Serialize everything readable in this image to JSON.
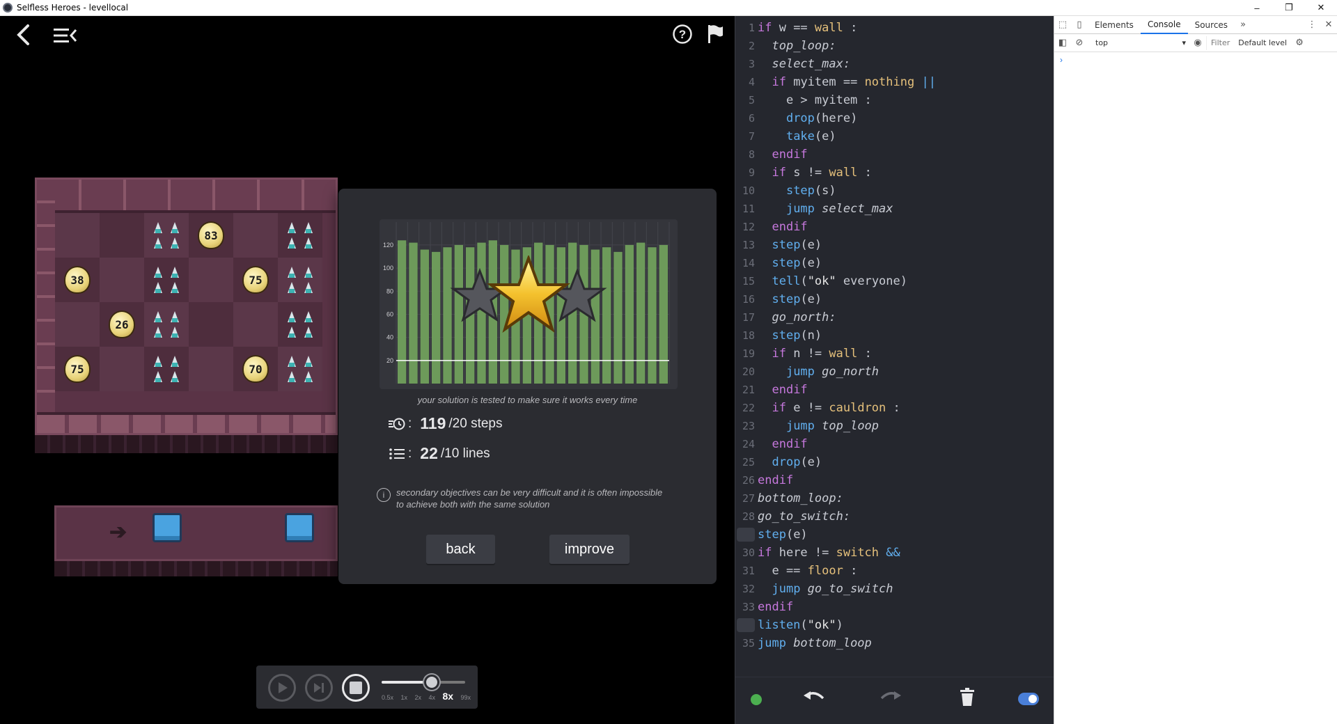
{
  "window": {
    "title": "Selfless Heroes - levellocal"
  },
  "board": {
    "rows": [
      [
        {
          "t": "a"
        },
        {
          "t": "b"
        },
        {
          "t": "a",
          "spikes": true
        },
        {
          "t": "b",
          "egg": "83"
        },
        {
          "t": "a"
        },
        {
          "t": "b",
          "spikes": true
        }
      ],
      [
        {
          "t": "b",
          "egg": "38"
        },
        {
          "t": "a"
        },
        {
          "t": "b",
          "spikes": true
        },
        {
          "t": "a"
        },
        {
          "t": "b",
          "egg": "75"
        },
        {
          "t": "a",
          "spikes": true
        }
      ],
      [
        {
          "t": "a"
        },
        {
          "t": "b",
          "egg": "26"
        },
        {
          "t": "a",
          "spikes": true
        },
        {
          "t": "b"
        },
        {
          "t": "a"
        },
        {
          "t": "b",
          "spikes": true
        }
      ],
      [
        {
          "t": "b",
          "egg": "75"
        },
        {
          "t": "a"
        },
        {
          "t": "b",
          "spikes": true
        },
        {
          "t": "a"
        },
        {
          "t": "b",
          "egg": "70"
        },
        {
          "t": "a",
          "spikes": true
        }
      ]
    ]
  },
  "results": {
    "caption": "your solution is tested to make sure it works every time",
    "steps_value": "119",
    "steps_target": "/20 steps",
    "lines_value": "22",
    "lines_target": "/10 lines",
    "note": "secondary objectives can be very difficult and it is often impossible to achieve both with the same solution",
    "back_label": "back",
    "improve_label": "improve",
    "stars_earned": 1,
    "stars_total": 3
  },
  "chart_data": {
    "type": "bar",
    "y_ticks": [
      20,
      40,
      60,
      80,
      100,
      120
    ],
    "ylim": [
      0,
      135
    ],
    "values": [
      124,
      122,
      116,
      114,
      118,
      120,
      118,
      122,
      124,
      120,
      116,
      118,
      122,
      120,
      118,
      122,
      120,
      116,
      118,
      114,
      120,
      122,
      118,
      120
    ],
    "reference_line": 20,
    "color": "#6d9a5a"
  },
  "player": {
    "speeds": [
      "0.5x",
      "1x",
      "2x",
      "4x",
      "8x",
      "99x"
    ],
    "selected_speed": "8x",
    "slider_fraction": 0.6
  },
  "code": [
    {
      "n": "1",
      "parts": [
        [
          "kw",
          "if "
        ],
        [
          "op",
          "w == "
        ],
        [
          "id",
          "wall"
        ],
        [
          "op",
          " :"
        ]
      ]
    },
    {
      "n": "2",
      "parts": [
        [
          "op",
          "  "
        ],
        [
          "lbl",
          "top_loop:"
        ]
      ]
    },
    {
      "n": "3",
      "parts": [
        [
          "op",
          "  "
        ],
        [
          "lbl",
          "select_max:"
        ]
      ]
    },
    {
      "n": "4",
      "parts": [
        [
          "op",
          "  "
        ],
        [
          "kw",
          "if "
        ],
        [
          "op",
          "myitem == "
        ],
        [
          "id",
          "nothing"
        ],
        [
          "op",
          " "
        ],
        [
          "fn",
          "||"
        ]
      ]
    },
    {
      "n": "5",
      "parts": [
        [
          "op",
          "    e > myitem :"
        ]
      ]
    },
    {
      "n": "6",
      "parts": [
        [
          "op",
          "    "
        ],
        [
          "fn",
          "drop"
        ],
        [
          "op",
          "(here)"
        ]
      ]
    },
    {
      "n": "7",
      "parts": [
        [
          "op",
          "    "
        ],
        [
          "fn",
          "take"
        ],
        [
          "op",
          "(e)"
        ]
      ]
    },
    {
      "n": "8",
      "parts": [
        [
          "op",
          "  "
        ],
        [
          "kw",
          "endif"
        ]
      ]
    },
    {
      "n": "9",
      "parts": [
        [
          "op",
          "  "
        ],
        [
          "kw",
          "if "
        ],
        [
          "op",
          "s != "
        ],
        [
          "id",
          "wall"
        ],
        [
          "op",
          " :"
        ]
      ]
    },
    {
      "n": "10",
      "parts": [
        [
          "op",
          "    "
        ],
        [
          "fn",
          "step"
        ],
        [
          "op",
          "(s)"
        ]
      ]
    },
    {
      "n": "11",
      "parts": [
        [
          "op",
          "    "
        ],
        [
          "fn",
          "jump "
        ],
        [
          "lbl",
          "select_max"
        ]
      ]
    },
    {
      "n": "12",
      "parts": [
        [
          "op",
          "  "
        ],
        [
          "kw",
          "endif"
        ]
      ]
    },
    {
      "n": "13",
      "parts": [
        [
          "op",
          "  "
        ],
        [
          "fn",
          "step"
        ],
        [
          "op",
          "(e)"
        ]
      ]
    },
    {
      "n": "14",
      "parts": [
        [
          "op",
          "  "
        ],
        [
          "fn",
          "step"
        ],
        [
          "op",
          "(e)"
        ]
      ]
    },
    {
      "n": "15",
      "parts": [
        [
          "op",
          "  "
        ],
        [
          "fn",
          "tell"
        ],
        [
          "op",
          "("
        ],
        [
          "str",
          "\"ok\""
        ],
        [
          "op",
          " everyone)"
        ]
      ]
    },
    {
      "n": "16",
      "parts": [
        [
          "op",
          "  "
        ],
        [
          "fn",
          "step"
        ],
        [
          "op",
          "(e)"
        ]
      ]
    },
    {
      "n": "17",
      "parts": [
        [
          "op",
          "  "
        ],
        [
          "lbl",
          "go_north:"
        ]
      ]
    },
    {
      "n": "18",
      "parts": [
        [
          "op",
          "  "
        ],
        [
          "fn",
          "step"
        ],
        [
          "op",
          "(n)"
        ]
      ]
    },
    {
      "n": "19",
      "parts": [
        [
          "op",
          "  "
        ],
        [
          "kw",
          "if "
        ],
        [
          "op",
          "n != "
        ],
        [
          "id",
          "wall"
        ],
        [
          "op",
          " :"
        ]
      ]
    },
    {
      "n": "20",
      "parts": [
        [
          "op",
          "    "
        ],
        [
          "fn",
          "jump "
        ],
        [
          "lbl",
          "go_north"
        ]
      ]
    },
    {
      "n": "21",
      "parts": [
        [
          "op",
          "  "
        ],
        [
          "kw",
          "endif"
        ]
      ]
    },
    {
      "n": "22",
      "parts": [
        [
          "op",
          "  "
        ],
        [
          "kw",
          "if "
        ],
        [
          "op",
          "e != "
        ],
        [
          "id",
          "cauldron"
        ],
        [
          "op",
          " :"
        ]
      ]
    },
    {
      "n": "23",
      "parts": [
        [
          "op",
          "    "
        ],
        [
          "fn",
          "jump "
        ],
        [
          "lbl",
          "top_loop"
        ]
      ]
    },
    {
      "n": "24",
      "parts": [
        [
          "op",
          "  "
        ],
        [
          "kw",
          "endif"
        ]
      ]
    },
    {
      "n": "25",
      "parts": [
        [
          "op",
          "  "
        ],
        [
          "fn",
          "drop"
        ],
        [
          "op",
          "(e)"
        ]
      ]
    },
    {
      "n": "26",
      "parts": [
        [
          "kw",
          "endif"
        ]
      ]
    },
    {
      "n": "27",
      "parts": [
        [
          "lbl",
          "bottom_loop:"
        ]
      ]
    },
    {
      "n": "28",
      "parts": [
        [
          "lbl",
          "go_to_switch:"
        ]
      ]
    },
    {
      "n": "",
      "marker": true,
      "parts": [
        [
          "fn",
          "step"
        ],
        [
          "op",
          "(e)"
        ]
      ]
    },
    {
      "n": "30",
      "parts": [
        [
          "kw",
          "if "
        ],
        [
          "op",
          "here != "
        ],
        [
          "id",
          "switch"
        ],
        [
          "op",
          " "
        ],
        [
          "fn",
          "&&"
        ]
      ]
    },
    {
      "n": "31",
      "parts": [
        [
          "op",
          "  e == "
        ],
        [
          "id",
          "floor"
        ],
        [
          "op",
          " :"
        ]
      ]
    },
    {
      "n": "32",
      "parts": [
        [
          "op",
          "  "
        ],
        [
          "fn",
          "jump "
        ],
        [
          "lbl",
          "go_to_switch"
        ]
      ]
    },
    {
      "n": "33",
      "parts": [
        [
          "kw",
          "endif"
        ]
      ]
    },
    {
      "n": "",
      "marker": true,
      "parts": [
        [
          "fn",
          "listen"
        ],
        [
          "op",
          "("
        ],
        [
          "str",
          "\"ok\""
        ],
        [
          "op",
          ")"
        ]
      ]
    },
    {
      "n": "35",
      "parts": [
        [
          "fn",
          "jump "
        ],
        [
          "lbl",
          "bottom_loop"
        ]
      ]
    }
  ],
  "devtools": {
    "tabs": [
      "Elements",
      "Console",
      "Sources"
    ],
    "active_tab": "Console",
    "context": "top",
    "filter_placeholder": "Filter",
    "level": "Default level",
    "prompt": "›"
  },
  "colors": {
    "editor_bg": "#25272e",
    "accent_blue": "#4a7fd8",
    "status_green": "#4caf50"
  }
}
